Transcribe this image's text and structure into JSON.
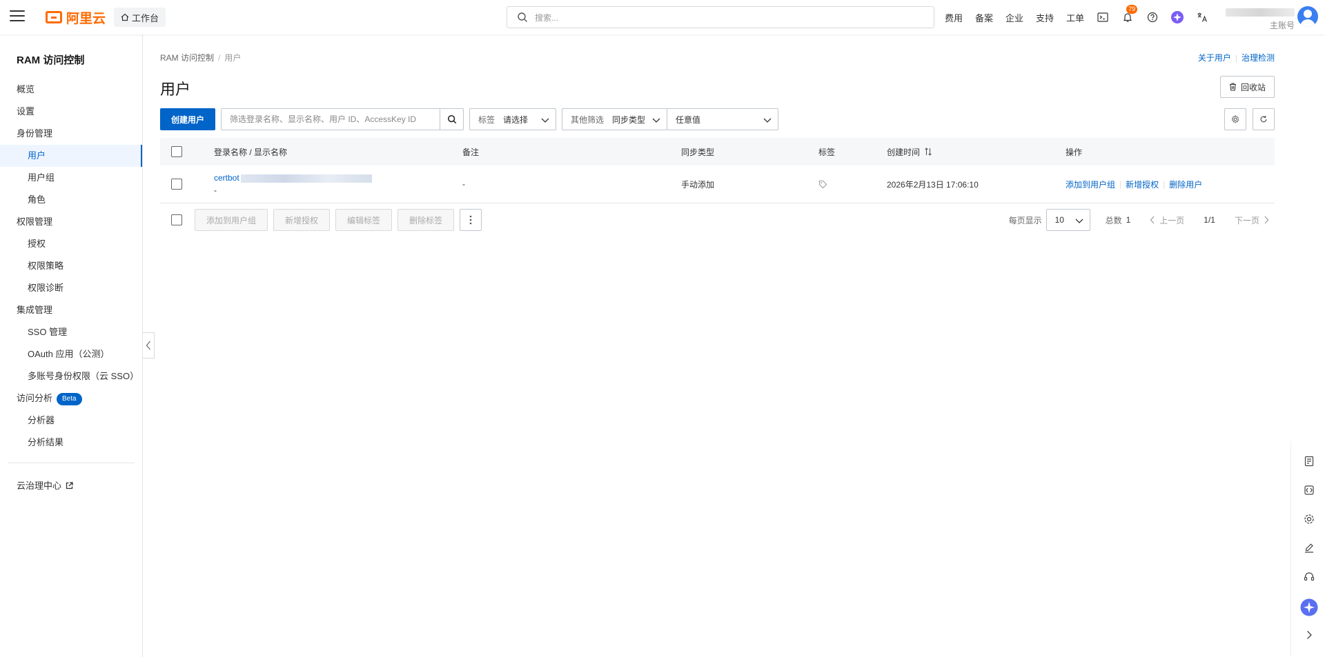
{
  "topbar": {
    "logo_text": "阿里云",
    "workbench_label": "工作台",
    "search_placeholder": "搜索...",
    "nav_items": [
      "费用",
      "备案",
      "企业",
      "支持",
      "工单"
    ],
    "notification_count": "79",
    "account_sub": "主账号"
  },
  "sidebar": {
    "title": "RAM 访问控制",
    "items": [
      {
        "label": "概览"
      },
      {
        "label": "设置"
      },
      {
        "label": "身份管理"
      },
      {
        "label": "用户"
      },
      {
        "label": "用户组"
      },
      {
        "label": "角色"
      },
      {
        "label": "权限管理"
      },
      {
        "label": "授权"
      },
      {
        "label": "权限策略"
      },
      {
        "label": "权限诊断"
      },
      {
        "label": "集成管理"
      },
      {
        "label": "SSO 管理"
      },
      {
        "label": "OAuth 应用（公测）"
      },
      {
        "label": "多账号身份权限（云 SSO）"
      },
      {
        "label": "访问分析"
      },
      {
        "label": "分析器"
      },
      {
        "label": "分析结果"
      }
    ],
    "beta_badge": "Beta",
    "footer_link": "云治理中心"
  },
  "main": {
    "breadcrumb": [
      "RAM 访问控制",
      "用户"
    ],
    "links": [
      "关于用户",
      "治理检测"
    ],
    "title": "用户",
    "recycle_label": "回收站",
    "create_button": "创建用户",
    "filter_placeholder": "筛选登录名称、显示名称、用户 ID、AccessKey ID",
    "tag_filter": {
      "label": "标签",
      "value": "请选择"
    },
    "other_filter": {
      "label": "其他筛选",
      "value": "同步类型"
    },
    "any_value": "任意值"
  },
  "table": {
    "columns": [
      "登录名称 / 显示名称",
      "备注",
      "同步类型",
      "标签",
      "创建时间",
      "操作"
    ],
    "rows": [
      {
        "login_name": "certbot",
        "display_name": "-",
        "note": "-",
        "sync_type": "手动添加",
        "created": "2026年2月13日 17:06:10",
        "ops": [
          "添加到用户组",
          "新增授权",
          "删除用户"
        ]
      }
    ]
  },
  "batch": {
    "buttons": [
      "添加到用户组",
      "新增授权",
      "编辑标签",
      "删除标签"
    ]
  },
  "pager": {
    "per_page_label": "每页显示",
    "per_page": "10",
    "total_label": "总数",
    "total": "1",
    "prev": "上一页",
    "page": "1/1",
    "next": "下一页"
  },
  "colors": {
    "primary": "#0064c8",
    "brand": "#ff6a00"
  }
}
